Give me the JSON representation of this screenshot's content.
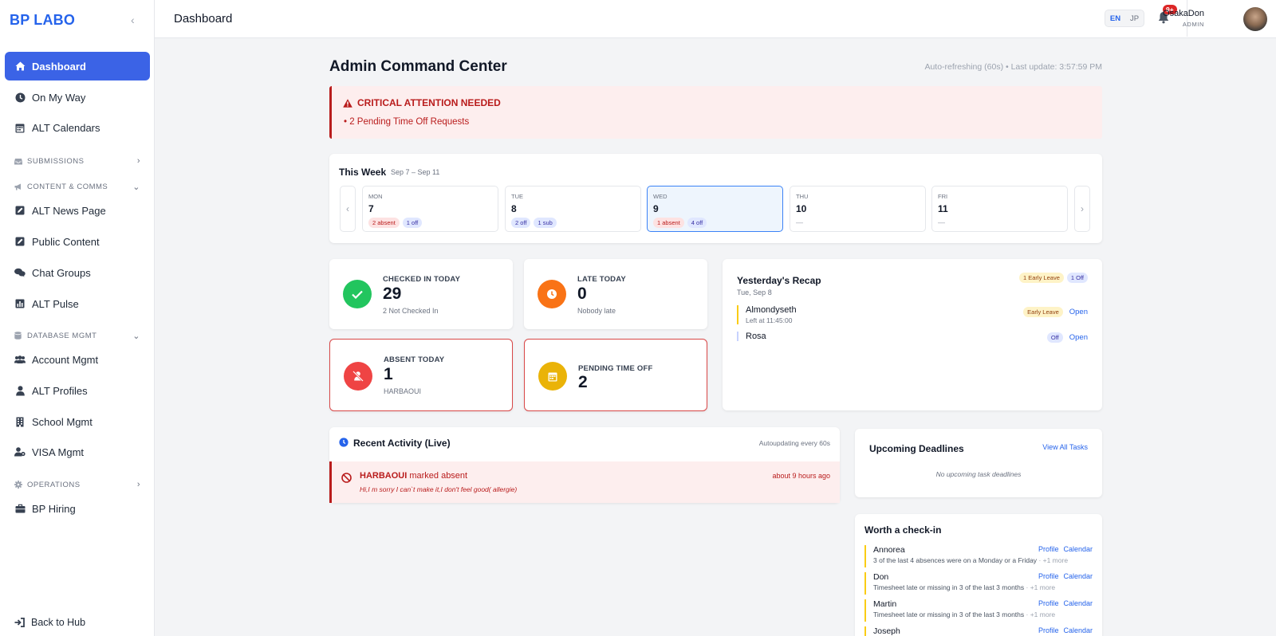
{
  "brand": "BP LABO",
  "sidebar": {
    "items": [
      {
        "label": "Dashboard",
        "icon": "home-icon"
      },
      {
        "label": "On My Way",
        "icon": "clock-icon"
      },
      {
        "label": "ALT Calendars",
        "icon": "calendar-icon"
      },
      {
        "label": "ALT News Page",
        "icon": "edit-icon"
      },
      {
        "label": "Public Content",
        "icon": "edit-icon"
      },
      {
        "label": "Chat Groups",
        "icon": "chat-icon"
      },
      {
        "label": "ALT Pulse",
        "icon": "bar-chart-icon"
      },
      {
        "label": "Account Mgmt",
        "icon": "users-icon"
      },
      {
        "label": "ALT Profiles",
        "icon": "user-icon"
      },
      {
        "label": "School Mgmt",
        "icon": "building-icon"
      },
      {
        "label": "VISA Mgmt",
        "icon": "user-cog-icon"
      },
      {
        "label": "BP Hiring",
        "icon": "briefcase-icon"
      }
    ],
    "sections": [
      {
        "label": "SUBMISSIONS",
        "icon": "inbox-icon",
        "state": "collapsed"
      },
      {
        "label": "CONTENT & COMMS",
        "icon": "megaphone-icon",
        "state": "expanded"
      },
      {
        "label": "DATABASE MGMT",
        "icon": "database-icon",
        "state": "expanded"
      },
      {
        "label": "OPERATIONS",
        "icon": "gear-icon",
        "state": "collapsed"
      }
    ],
    "back": "Back to Hub"
  },
  "header": {
    "title": "Dashboard",
    "lang_en": "EN",
    "lang_jp": "JP",
    "notif_badge": "9+",
    "user_name": "OsakaDon",
    "user_role": "ADMIN"
  },
  "main": {
    "title": "Admin Command Center",
    "refresh": "Auto-refreshing (60s) • Last update: 3:57:59 PM",
    "alert_title": "CRITICAL ATTENTION NEEDED",
    "alert_item": "• 2 Pending Time Off Requests",
    "week": {
      "title": "This Week",
      "range": "Sep 7 – Sep 11",
      "days": [
        {
          "name": "MON",
          "date": "7",
          "tags": [
            {
              "text": "2 absent",
              "color": "red"
            },
            {
              "text": "1 off",
              "color": "blue"
            }
          ]
        },
        {
          "name": "TUE",
          "date": "8",
          "tags": [
            {
              "text": "2 off",
              "color": "blue"
            },
            {
              "text": "1 sub",
              "color": "blue"
            }
          ]
        },
        {
          "name": "WED",
          "date": "9",
          "tags": [
            {
              "text": "1 absent",
              "color": "red"
            },
            {
              "text": "4 off",
              "color": "blue"
            }
          ]
        },
        {
          "name": "THU",
          "date": "10",
          "empty": "—"
        },
        {
          "name": "FRI",
          "date": "11",
          "empty": "—"
        }
      ]
    },
    "stats": {
      "checked": {
        "label": "CHECKED IN TODAY",
        "value": "29",
        "sub": "2 Not Checked In",
        "color": "#22c55e"
      },
      "late": {
        "label": "LATE TODAY",
        "value": "0",
        "sub": "Nobody late",
        "color": "#f97316"
      },
      "absent": {
        "label": "ABSENT TODAY",
        "value": "1",
        "sub": "HARBAOUI",
        "color": "#ef4444"
      },
      "pending": {
        "label": "PENDING TIME OFF",
        "value": "2",
        "color": "#eab308"
      }
    },
    "recap": {
      "title": "Yesterday's Recap",
      "date": "Tue, Sep 8",
      "tag1": "1 Early Leave",
      "tag2": "1 Off",
      "rows": [
        {
          "name": "Almondyseth",
          "sub": "Left at 11:45:00",
          "tag": "Early Leave",
          "link": "Open"
        },
        {
          "name": "Rosa",
          "tag": "Off",
          "link": "Open"
        }
      ]
    },
    "activity": {
      "title": "Recent Activity (Live)",
      "auto": "Autoupdating every 60s",
      "name": "HARBAOUI",
      "action": " marked absent",
      "note": "Hi,I m sorry I can`t make it,I don't feel good( allergie)",
      "time": "about 9 hours ago"
    },
    "deadlines": {
      "title": "Upcoming Deadlines",
      "link": "View All Tasks",
      "empty": "No upcoming task deadlines"
    },
    "checkin": {
      "title": "Worth a check-in",
      "profile": "Profile",
      "calendar": "Calendar",
      "rows": [
        {
          "name": "Annorea",
          "sub": "3 of the last 4 absences were on a Monday or a Friday",
          "more": "· +1 more"
        },
        {
          "name": "Don",
          "sub": "Timesheet late or missing in 3 of the last 3 months",
          "more": "· +1 more"
        },
        {
          "name": "Martin",
          "sub": "Timesheet late or missing in 3 of the last 3 months",
          "more": "· +1 more"
        },
        {
          "name": "Joseph",
          "sub": "",
          "more": ""
        }
      ]
    }
  }
}
